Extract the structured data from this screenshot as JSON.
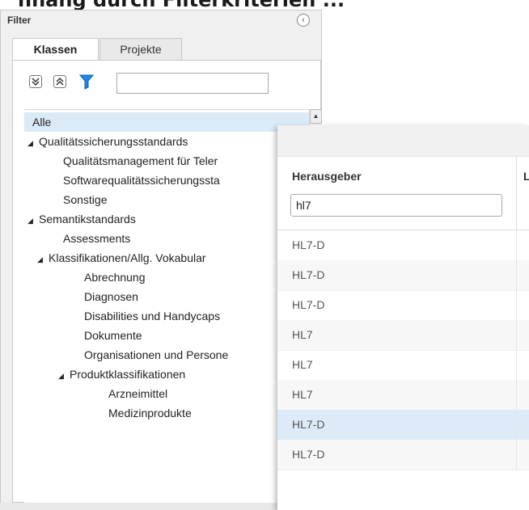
{
  "page_heading": "nhang durch Filterkriterien ...",
  "filter": {
    "title": "Filter",
    "collapse_icon": "‹",
    "tabs": [
      {
        "label": "Klassen",
        "active": true
      },
      {
        "label": "Projekte",
        "active": false
      }
    ],
    "toolbar": {
      "expand_all_icon": "double-chevron-down-icon",
      "collapse_all_icon": "double-chevron-up-icon",
      "filter_icon": "funnel-icon",
      "search_value": ""
    },
    "tree": [
      {
        "label": "Alle",
        "level": 0,
        "toggle": "",
        "selected": true
      },
      {
        "label": "Qualitätssicherungsstandards",
        "level": 0,
        "toggle": "◢"
      },
      {
        "label": "Qualitätsmanagement für Teler",
        "level": 2,
        "toggle": ""
      },
      {
        "label": "Softwarequalitätssicherungssta",
        "level": 2,
        "toggle": ""
      },
      {
        "label": "Sonstige",
        "level": 2,
        "toggle": ""
      },
      {
        "label": "Semantikstandards",
        "level": 0,
        "toggle": "◢"
      },
      {
        "label": "Assessments",
        "level": 2,
        "toggle": ""
      },
      {
        "label": "Klassifikationen/Allg. Vokabular",
        "level": 1,
        "toggle": "◢"
      },
      {
        "label": "Abrechnung",
        "level": 3,
        "toggle": ""
      },
      {
        "label": "Diagnosen",
        "level": 3,
        "toggle": ""
      },
      {
        "label": "Disabilities und Handycaps",
        "level": 3,
        "toggle": ""
      },
      {
        "label": "Dokumente",
        "level": 3,
        "toggle": ""
      },
      {
        "label": "Organisationen und Persone",
        "level": 3,
        "toggle": ""
      },
      {
        "label": "Produktklassifikationen",
        "level": 2,
        "toggle": "◢"
      },
      {
        "label": "Arzneimittel",
        "level": 4,
        "toggle": ""
      },
      {
        "label": "Medizinprodukte",
        "level": 4,
        "toggle": ""
      }
    ]
  },
  "grid": {
    "column_label": "Herausgeber",
    "next_column_label": "L",
    "filter_value": "hl7",
    "rows": [
      {
        "value": "HL7-D",
        "selected": false
      },
      {
        "value": "HL7-D",
        "selected": false
      },
      {
        "value": "HL7-D",
        "selected": false
      },
      {
        "value": "HL7",
        "selected": false
      },
      {
        "value": "HL7",
        "selected": false
      },
      {
        "value": "HL7",
        "selected": false
      },
      {
        "value": "HL7-D",
        "selected": true
      },
      {
        "value": "HL7-D",
        "selected": false
      }
    ]
  },
  "colors": {
    "selection": "#dcebf7",
    "funnel": "#1e88e5"
  }
}
